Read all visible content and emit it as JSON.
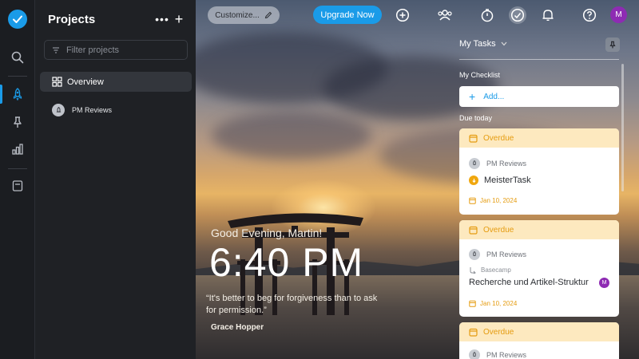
{
  "projects_panel": {
    "title": "Projects",
    "more_label": "•••",
    "add_label": "+",
    "filter_placeholder": "Filter projects",
    "overview_label": "Overview",
    "project_label": "PM Reviews"
  },
  "topbar": {
    "customize_label": "Customize...",
    "upgrade_label": "Upgrade Now",
    "avatar_initial": "M"
  },
  "hero": {
    "greeting": "Good Evening, Martin!",
    "time": "6:40 PM",
    "quote": "“It's better to beg for forgiveness than to ask for permission.”",
    "author": "Grace Hopper"
  },
  "tasks_panel": {
    "title": "My Tasks",
    "checklist_label": "My Checklist",
    "add_label": "Add...",
    "due_label": "Due today",
    "tasks": [
      {
        "status": "Overdue",
        "project": "PM Reviews",
        "name": "MeisterTask",
        "date": "Jan 10, 2024"
      },
      {
        "status": "Overdue",
        "project": "PM Reviews",
        "subsection": "Basecamp",
        "name": "Recherche und Artikel-Struktur",
        "date": "Jan 10, 2024",
        "assignee": "M"
      },
      {
        "status": "Overdue",
        "project": "PM Reviews"
      }
    ]
  },
  "colors": {
    "accent": "#1a9be8",
    "overdue": "#e59c10",
    "overdue_bg": "#fde9bf",
    "avatar": "#8e2bb3",
    "sidebar": "#1b1d21"
  }
}
